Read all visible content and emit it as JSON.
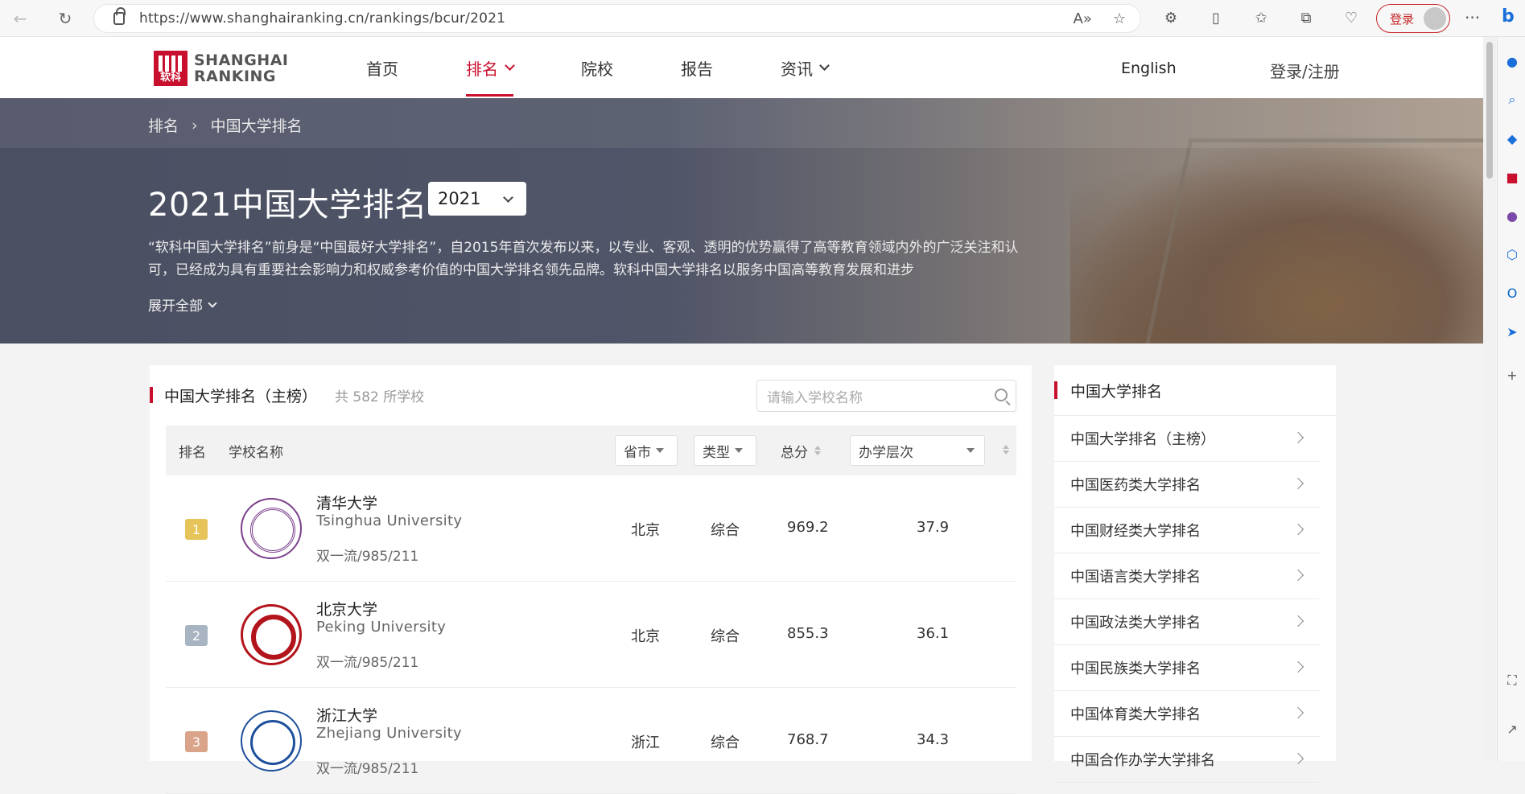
{
  "browser": {
    "url": "https://www.shanghairanking.cn/rankings/bcur/2021",
    "login_label": "登录"
  },
  "site": {
    "logo_top": "SHANGHAI",
    "logo_bottom": "RANKING",
    "logo_mark": "软科",
    "nav": [
      "首页",
      "排名",
      "院校",
      "报告",
      "资讯"
    ],
    "language": "English",
    "login_register": "登录/注册"
  },
  "banner": {
    "breadcrumb": [
      "排名",
      "中国大学排名"
    ],
    "title": "2021中国大学排名",
    "year": "2021",
    "description": "“软科中国大学排名”前身是“中国最好大学排名”，自2015年首次发布以来，以专业、客观、透明的优势赢得了高等教育领域内外的广泛关注和认可，已经成为具有重要社会影响力和权威参考价值的中国大学排名领先品牌。软科中国大学排名以服务中国高等教育发展和进步",
    "expand": "展开全部"
  },
  "ranking": {
    "title": "中国大学排名（主榜）",
    "count": "共 582 所学校",
    "search_placeholder": "请输入学校名称",
    "headers": {
      "rank": "排名",
      "name": "学校名称",
      "province": "省市",
      "type": "类型",
      "score": "总分",
      "level": "办学层次"
    },
    "rows": [
      {
        "rank": "1",
        "name_cn": "清华大学",
        "name_en": "Tsinghua University",
        "tags": "双一流/985/211",
        "province": "北京",
        "type": "综合",
        "score": "969.2",
        "level": "37.9",
        "badge_color": "#e6c45a",
        "emblem_color": "#7b3f8c"
      },
      {
        "rank": "2",
        "name_cn": "北京大学",
        "name_en": "Peking University",
        "tags": "双一流/985/211",
        "province": "北京",
        "type": "综合",
        "score": "855.3",
        "level": "36.1",
        "badge_color": "#a9b4c2",
        "emblem_color": "#b3141c"
      },
      {
        "rank": "3",
        "name_cn": "浙江大学",
        "name_en": "Zhejiang University",
        "tags": "双一流/985/211",
        "province": "浙江",
        "type": "综合",
        "score": "768.7",
        "level": "34.3",
        "badge_color": "#d9a48a",
        "emblem_color": "#1d4f9c"
      }
    ]
  },
  "sidebar": {
    "title": "中国大学排名",
    "items": [
      "中国大学排名（主榜）",
      "中国医药类大学排名",
      "中国财经类大学排名",
      "中国语言类大学排名",
      "中国政法类大学排名",
      "中国民族类大学排名",
      "中国体育类大学排名",
      "中国合作办学大学排名"
    ]
  },
  "colors": {
    "brand_red": "#c8102e"
  }
}
